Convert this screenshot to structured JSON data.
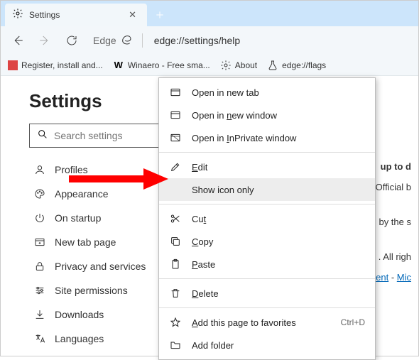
{
  "tab": {
    "title": "Settings"
  },
  "address": {
    "prefix": "Edge",
    "url": "edge://settings/help"
  },
  "bookmarks": {
    "b1": "Register, install and...",
    "b2": "Winaero - Free sma...",
    "b3": "About",
    "b4": "edge://flags"
  },
  "page": {
    "title": "Settings"
  },
  "search": {
    "placeholder": "Search settings"
  },
  "nav": {
    "profiles": "Profiles",
    "appearance": "Appearance",
    "onstartup": "On startup",
    "newtab": "New tab page",
    "privacy": "Privacy and services",
    "siteperm": "Site permissions",
    "downloads": "Downloads",
    "languages": "Languages"
  },
  "right": {
    "up": "up to d",
    "official": "Official b",
    "bythe": "by the s",
    "allrigh": ". All righ",
    "ent": "ent",
    "mic": "Mic"
  },
  "ctx": {
    "open_tab": "Open in new tab",
    "open_win_pre": "Open in ",
    "open_win_acc": "n",
    "open_win_post": "ew window",
    "open_inpriv_pre": "Open in ",
    "open_inpriv_acc": "I",
    "open_inpriv_post": "nPrivate window",
    "edit_acc": "E",
    "edit_post": "dit",
    "showicon": "Show icon only",
    "cut_pre": "Cu",
    "cut_acc": "t",
    "copy_acc": "C",
    "copy_post": "opy",
    "paste_acc": "P",
    "paste_post": "aste",
    "delete_acc": "D",
    "delete_post": "elete",
    "addfav_acc": "A",
    "addfav_post": "dd this page to favorites",
    "addfav_short": "Ctrl+D",
    "addfolder": "Add folder"
  }
}
